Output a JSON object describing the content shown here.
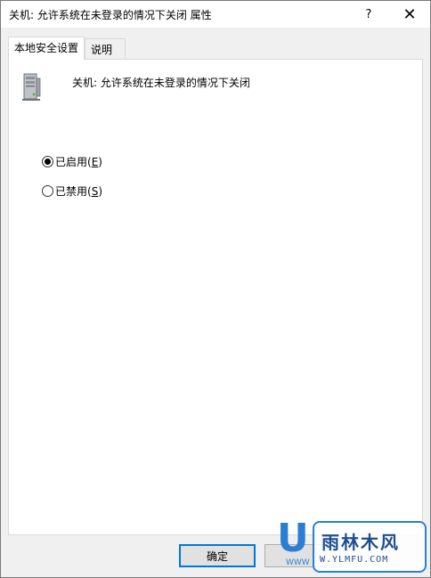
{
  "window": {
    "title": "关机: 允许系统在未登录的情况下关闭 属性",
    "help_label": "?",
    "close_label": "✕"
  },
  "tabs": [
    {
      "label": "本地安全设置",
      "active": true
    },
    {
      "label": "说明",
      "active": false
    }
  ],
  "policy": {
    "icon": "server-computer-icon",
    "name": "关机: 允许系统在未登录的情况下关闭"
  },
  "options": {
    "enabled": {
      "label": "已启用",
      "hotkey": "E",
      "checked": true
    },
    "disabled": {
      "label": "已禁用",
      "hotkey": "S",
      "checked": false
    }
  },
  "buttons": {
    "ok_label": "确定",
    "cancel_label": ""
  },
  "watermark": {
    "letter": "U",
    "site_name": "雨林木风",
    "url": "W.YLMFU.COM",
    "prefix": "WWW"
  },
  "colors": {
    "accent": "#0078d7",
    "watermark_blue": "#2a7fd4"
  }
}
